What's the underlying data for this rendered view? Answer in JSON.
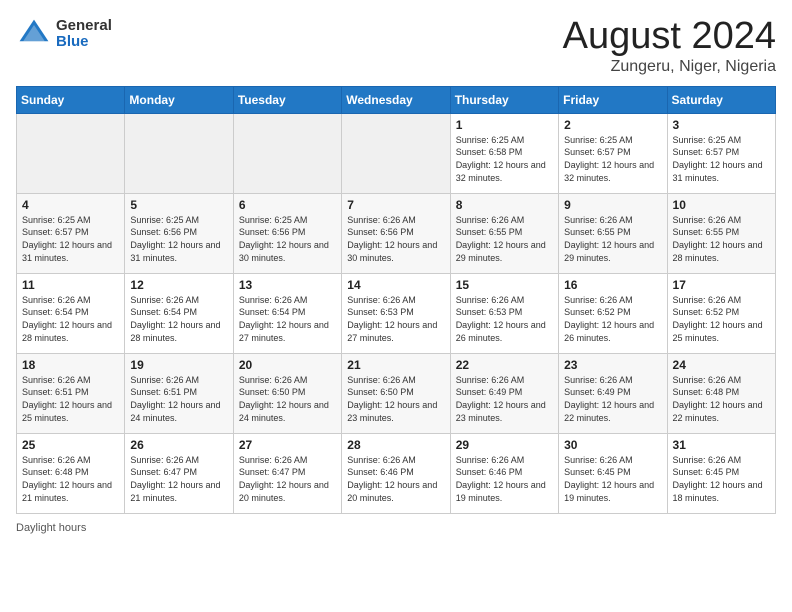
{
  "logo": {
    "general": "General",
    "blue": "Blue"
  },
  "title": "August 2024",
  "location": "Zungeru, Niger, Nigeria",
  "days_of_week": [
    "Sunday",
    "Monday",
    "Tuesday",
    "Wednesday",
    "Thursday",
    "Friday",
    "Saturday"
  ],
  "weeks": [
    [
      {
        "day": "",
        "info": ""
      },
      {
        "day": "",
        "info": ""
      },
      {
        "day": "",
        "info": ""
      },
      {
        "day": "",
        "info": ""
      },
      {
        "day": "1",
        "info": "Sunrise: 6:25 AM\nSunset: 6:58 PM\nDaylight: 12 hours and 32 minutes."
      },
      {
        "day": "2",
        "info": "Sunrise: 6:25 AM\nSunset: 6:57 PM\nDaylight: 12 hours and 32 minutes."
      },
      {
        "day": "3",
        "info": "Sunrise: 6:25 AM\nSunset: 6:57 PM\nDaylight: 12 hours and 31 minutes."
      }
    ],
    [
      {
        "day": "4",
        "info": "Sunrise: 6:25 AM\nSunset: 6:57 PM\nDaylight: 12 hours and 31 minutes."
      },
      {
        "day": "5",
        "info": "Sunrise: 6:25 AM\nSunset: 6:56 PM\nDaylight: 12 hours and 31 minutes."
      },
      {
        "day": "6",
        "info": "Sunrise: 6:25 AM\nSunset: 6:56 PM\nDaylight: 12 hours and 30 minutes."
      },
      {
        "day": "7",
        "info": "Sunrise: 6:26 AM\nSunset: 6:56 PM\nDaylight: 12 hours and 30 minutes."
      },
      {
        "day": "8",
        "info": "Sunrise: 6:26 AM\nSunset: 6:55 PM\nDaylight: 12 hours and 29 minutes."
      },
      {
        "day": "9",
        "info": "Sunrise: 6:26 AM\nSunset: 6:55 PM\nDaylight: 12 hours and 29 minutes."
      },
      {
        "day": "10",
        "info": "Sunrise: 6:26 AM\nSunset: 6:55 PM\nDaylight: 12 hours and 28 minutes."
      }
    ],
    [
      {
        "day": "11",
        "info": "Sunrise: 6:26 AM\nSunset: 6:54 PM\nDaylight: 12 hours and 28 minutes."
      },
      {
        "day": "12",
        "info": "Sunrise: 6:26 AM\nSunset: 6:54 PM\nDaylight: 12 hours and 28 minutes."
      },
      {
        "day": "13",
        "info": "Sunrise: 6:26 AM\nSunset: 6:54 PM\nDaylight: 12 hours and 27 minutes."
      },
      {
        "day": "14",
        "info": "Sunrise: 6:26 AM\nSunset: 6:53 PM\nDaylight: 12 hours and 27 minutes."
      },
      {
        "day": "15",
        "info": "Sunrise: 6:26 AM\nSunset: 6:53 PM\nDaylight: 12 hours and 26 minutes."
      },
      {
        "day": "16",
        "info": "Sunrise: 6:26 AM\nSunset: 6:52 PM\nDaylight: 12 hours and 26 minutes."
      },
      {
        "day": "17",
        "info": "Sunrise: 6:26 AM\nSunset: 6:52 PM\nDaylight: 12 hours and 25 minutes."
      }
    ],
    [
      {
        "day": "18",
        "info": "Sunrise: 6:26 AM\nSunset: 6:51 PM\nDaylight: 12 hours and 25 minutes."
      },
      {
        "day": "19",
        "info": "Sunrise: 6:26 AM\nSunset: 6:51 PM\nDaylight: 12 hours and 24 minutes."
      },
      {
        "day": "20",
        "info": "Sunrise: 6:26 AM\nSunset: 6:50 PM\nDaylight: 12 hours and 24 minutes."
      },
      {
        "day": "21",
        "info": "Sunrise: 6:26 AM\nSunset: 6:50 PM\nDaylight: 12 hours and 23 minutes."
      },
      {
        "day": "22",
        "info": "Sunrise: 6:26 AM\nSunset: 6:49 PM\nDaylight: 12 hours and 23 minutes."
      },
      {
        "day": "23",
        "info": "Sunrise: 6:26 AM\nSunset: 6:49 PM\nDaylight: 12 hours and 22 minutes."
      },
      {
        "day": "24",
        "info": "Sunrise: 6:26 AM\nSunset: 6:48 PM\nDaylight: 12 hours and 22 minutes."
      }
    ],
    [
      {
        "day": "25",
        "info": "Sunrise: 6:26 AM\nSunset: 6:48 PM\nDaylight: 12 hours and 21 minutes."
      },
      {
        "day": "26",
        "info": "Sunrise: 6:26 AM\nSunset: 6:47 PM\nDaylight: 12 hours and 21 minutes."
      },
      {
        "day": "27",
        "info": "Sunrise: 6:26 AM\nSunset: 6:47 PM\nDaylight: 12 hours and 20 minutes."
      },
      {
        "day": "28",
        "info": "Sunrise: 6:26 AM\nSunset: 6:46 PM\nDaylight: 12 hours and 20 minutes."
      },
      {
        "day": "29",
        "info": "Sunrise: 6:26 AM\nSunset: 6:46 PM\nDaylight: 12 hours and 19 minutes."
      },
      {
        "day": "30",
        "info": "Sunrise: 6:26 AM\nSunset: 6:45 PM\nDaylight: 12 hours and 19 minutes."
      },
      {
        "day": "31",
        "info": "Sunrise: 6:26 AM\nSunset: 6:45 PM\nDaylight: 12 hours and 18 minutes."
      }
    ]
  ],
  "footer": {
    "daylight_label": "Daylight hours"
  }
}
